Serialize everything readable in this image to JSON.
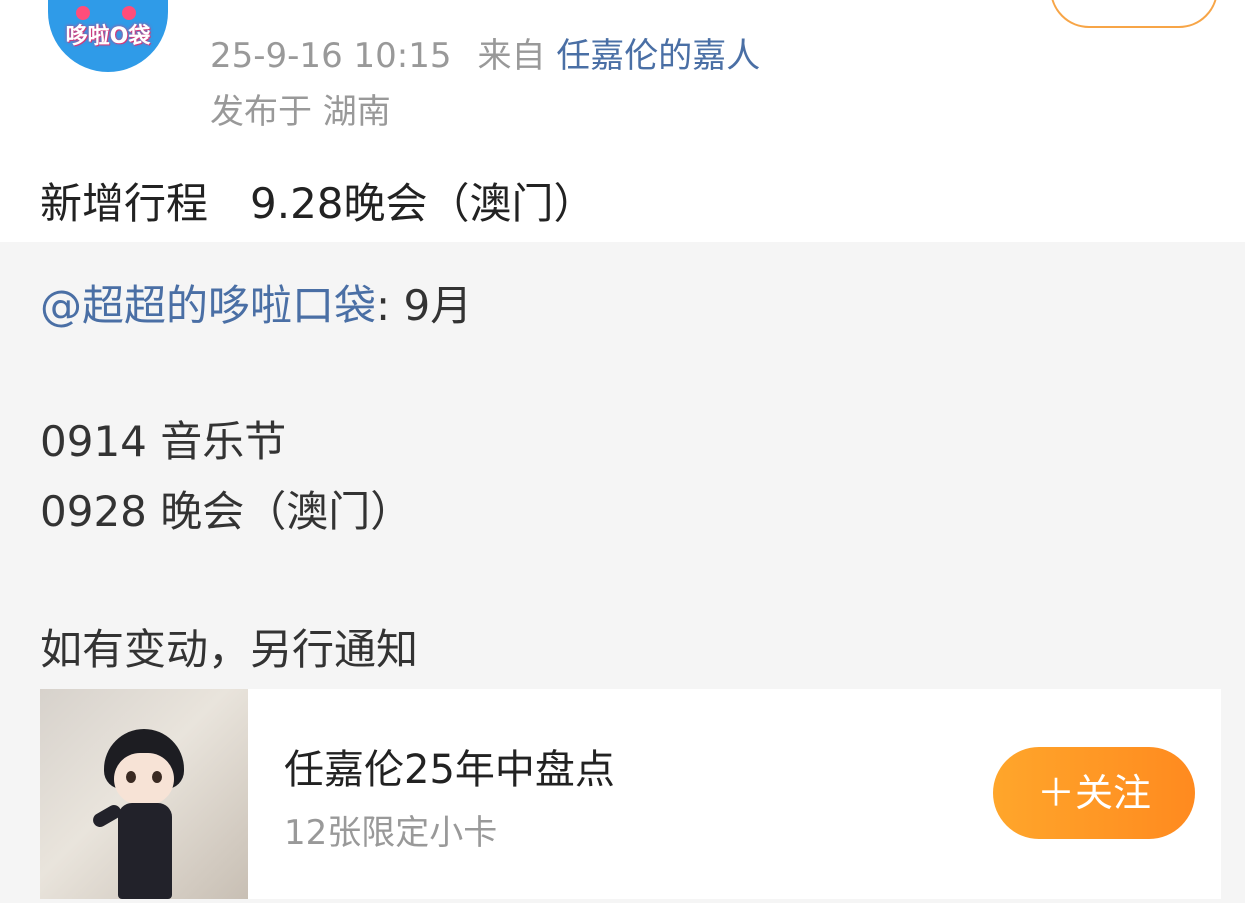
{
  "post": {
    "time": "25-9-16 10:15",
    "source_prefix": "来自",
    "source_name": "任嘉伦的嘉人",
    "location": "发布于 湖南",
    "text": "新增行程　9.28晚会（澳门）"
  },
  "quote": {
    "mention": "@超超的哆啦口袋",
    "first_line_rest": ": 9月",
    "line2": "0914 音乐节",
    "line3": "0928 晚会（澳门）",
    "line4": "如有变动，另行通知"
  },
  "card": {
    "title": "任嘉伦25年中盘点",
    "subtitle": "12张限定小卡",
    "follow_label": "＋关注"
  },
  "avatar": {
    "logo_text": "哆啦O袋"
  },
  "colors": {
    "link": "#4a6fa5",
    "accent": "#ff9a26",
    "avatar_bg": "#2f9be8"
  },
  "icons": {
    "avatar": "doraemon-pocket-logo",
    "card_thumbnail": "chibi-character-image"
  }
}
